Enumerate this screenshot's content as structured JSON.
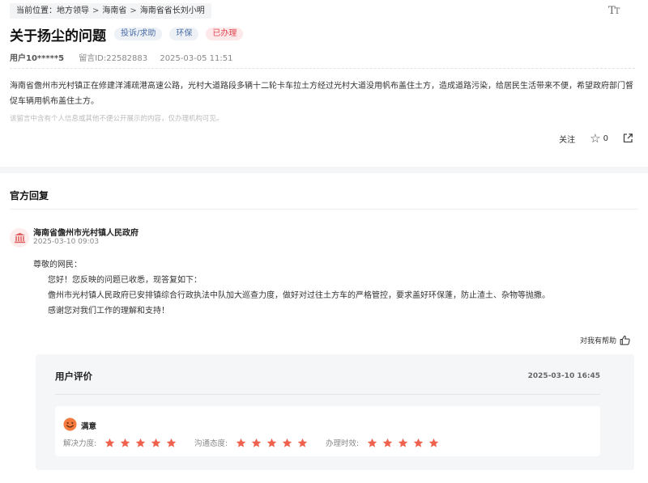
{
  "breadcrumb": {
    "prefix": "当前位置：",
    "items": [
      "地方领导",
      "海南省",
      "海南省省长刘小明"
    ],
    "separator": ">"
  },
  "font_toggle_icon": "text-size-icon",
  "message": {
    "title": "关于扬尘的问题",
    "tags": {
      "type": "投诉/求助",
      "category": "环保",
      "status": "已办理"
    },
    "user": "用户10*****5",
    "message_id": "留言ID:22582883",
    "datetime": "2025-03-05 11:51",
    "content": "海南省儋州市光村镇正在修建洋浦疏港高速公路，光村大道路段多辆十二轮卡车拉土方经过光村大道没用帆布盖住土方，造成道路污染，给居民生活带来不便，希望政府部门督促车辆用帆布盖住土方。",
    "privacy_notice": "该留言中含有个人信息或其他不便公开展示的内容，仅办理机构可见。"
  },
  "actions": {
    "follow_label": "关注",
    "star_count": "0",
    "icons": [
      "star-icon",
      "share-icon"
    ]
  },
  "official_reply": {
    "section_title": "官方回复",
    "org_name": "海南省儋州市光村镇人民政府",
    "date": "2025-03-10 09:03",
    "org_icon": "government-building-icon",
    "lines": [
      "尊敬的网民：",
      "您好！您反映的问题已收悉，现答复如下：",
      "儋州市光村镇人民政府已安排镇综合行政执法中队加大巡查力度，做好对过往土方车的严格管控，要求盖好环保蓬，防止渣土、杂物等抛撒。",
      "感谢您对我们工作的理解和支持！"
    ],
    "helpful_label": "对我有帮助"
  },
  "evaluation": {
    "title": "用户评价",
    "date": "2025-03-10 16:45",
    "overall": "满意",
    "accent_color": "#f0624d",
    "ratings": [
      {
        "label": "解决力度:",
        "stars": 5,
        "max": 5
      },
      {
        "label": "沟通态度:",
        "stars": 5,
        "max": 5
      },
      {
        "label": "办理时效:",
        "stars": 5,
        "max": 5
      }
    ]
  }
}
